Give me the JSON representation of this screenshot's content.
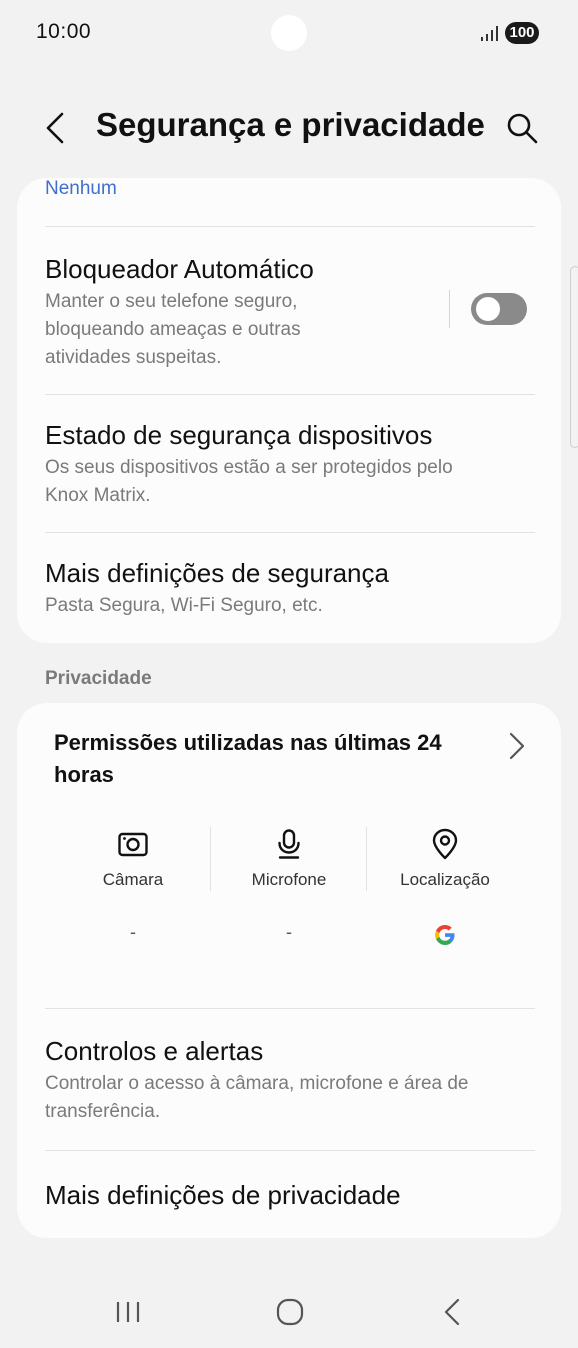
{
  "status_bar": {
    "time": "10:00",
    "battery": "100",
    "icons": [
      "signal-icon",
      "battery-icon"
    ]
  },
  "header": {
    "title": "Segurança e privacidade",
    "back_icon": "chevron-left-icon",
    "search_icon": "search-icon"
  },
  "security_card": {
    "top_link": "Nenhum",
    "items": [
      {
        "title": "Bloqueador Automático",
        "subtitle_lines": [
          "Manter o seu telefone seguro,",
          "bloqueando ameaças e outras",
          "atividades suspeitas."
        ],
        "toggle": false
      },
      {
        "title": "Estado de segurança dispositivos",
        "subtitle_lines": [
          "Os seus dispositivos estão a ser protegidos pelo",
          "Knox Matrix."
        ]
      },
      {
        "title": "Mais definições de segurança",
        "subtitle_lines": [
          "Pasta Segura, Wi-Fi Seguro, etc."
        ]
      }
    ]
  },
  "privacy_section": {
    "label": "Privacidade",
    "permissions_title": "Permissões utilizadas nas últimas 24 horas",
    "permissions": [
      {
        "label": "Câmara",
        "icon": "camera-icon",
        "value": "-"
      },
      {
        "label": "Microfone",
        "icon": "microphone-icon",
        "value": "-"
      },
      {
        "label": "Localização",
        "icon": "location-icon",
        "value": "google-logo-icon"
      }
    ],
    "items": [
      {
        "title": "Controlos e alertas",
        "subtitle_lines": [
          "Controlar o acesso à câmara, microfone e área de",
          "transferência."
        ]
      },
      {
        "title": "Mais definições de privacidade"
      }
    ]
  },
  "nav_bar": {
    "buttons": [
      "recents-icon",
      "home-icon",
      "back-icon"
    ]
  },
  "colors": {
    "background": "#f2f2f2",
    "card": "#fcfcfc",
    "link": "#3e6ecf",
    "toggle_off": "#8a8a8a",
    "subtitle": "#7a7a7a"
  }
}
